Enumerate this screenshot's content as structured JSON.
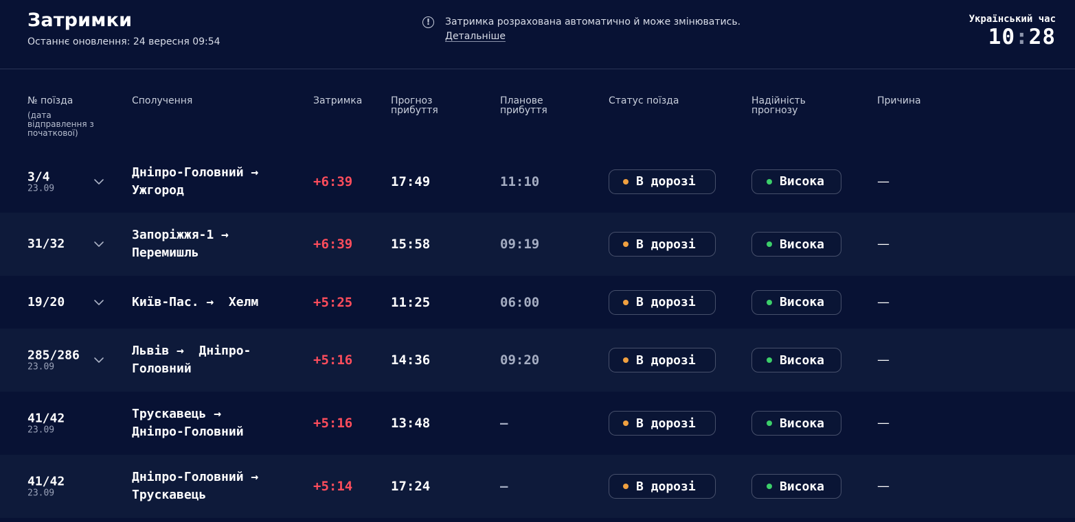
{
  "header": {
    "title": "Затримки",
    "updated": "Останнє оновлення: 24 вересня 09:54",
    "notice": "Затримка розрахована автоматично й може змінюватись.",
    "notice_link": "Детальніше",
    "notice_icon": "!",
    "clock_label": "Український час",
    "clock_hours": "10",
    "clock_separator": ":",
    "clock_minutes": "28"
  },
  "columns": {
    "train": "№ поїзда",
    "train_sub": "(дата відправлення з початкової)",
    "route": "Сполучення",
    "delay": "Затримка",
    "forecast": "Прогноз прибуття",
    "planned": "Планове прибуття",
    "status": "Статус поїзда",
    "reliability": "Надійність прогнозу",
    "reason": "Причина"
  },
  "colors": {
    "background": "#081234",
    "row_alt": "#0e1a3a",
    "delay": "#ff4d5c",
    "status_dot": "#f0a040",
    "reliability_dot": "#3ccf6a"
  },
  "icons": {
    "arrow": "→",
    "expand": "chevron-down-icon",
    "info": "info-icon"
  },
  "rows": [
    {
      "train": "3/4",
      "date": "23.09",
      "from": "Дніпро-Головний",
      "to": "Ужгород",
      "route_line1": "Дніпро-Головний →",
      "route_line2": "Ужгород",
      "delay": "+6:39",
      "forecast": "17:49",
      "planned": "11:10",
      "status": "В дорозі",
      "reliability": "Висока",
      "reason": "—",
      "expandable": true
    },
    {
      "train": "31/32",
      "date": "",
      "from": "Запоріжжя-1",
      "to": "Перемишль",
      "route_line1": "Запоріжжя-1 →",
      "route_line2": "Перемишль",
      "delay": "+6:39",
      "forecast": "15:58",
      "planned": "09:19",
      "status": "В дорозі",
      "reliability": "Висока",
      "reason": "—",
      "expandable": true
    },
    {
      "train": "19/20",
      "date": "",
      "from": "Київ-Пас.",
      "to": "Хелм",
      "route_line1": "Київ-Пас. →  Хелм",
      "route_line2": "",
      "delay": "+5:25",
      "forecast": "11:25",
      "planned": "06:00",
      "status": "В дорозі",
      "reliability": "Висока",
      "reason": "—",
      "expandable": true
    },
    {
      "train": "285/286",
      "date": "23.09",
      "from": "Львів",
      "to": "Дніпро-Головний",
      "route_line1": "Львів →  Дніпро-",
      "route_line2": "Головний",
      "delay": "+5:16",
      "forecast": "14:36",
      "planned": "09:20",
      "status": "В дорозі",
      "reliability": "Висока",
      "reason": "—",
      "expandable": true
    },
    {
      "train": "41/42",
      "date": "23.09",
      "from": "Трускавець",
      "to": "Дніпро-Головний",
      "route_line1": "Трускавець →",
      "route_line2": "Дніпро-Головний",
      "delay": "+5:16",
      "forecast": "13:48",
      "planned": "—",
      "status": "В дорозі",
      "reliability": "Висока",
      "reason": "—",
      "expandable": false
    },
    {
      "train": "41/42",
      "date": "23.09",
      "from": "Дніпро-Головний",
      "to": "Трускавець",
      "route_line1": "Дніпро-Головний →",
      "route_line2": "Трускавець",
      "delay": "+5:14",
      "forecast": "17:24",
      "planned": "—",
      "status": "В дорозі",
      "reliability": "Висока",
      "reason": "—",
      "expandable": false
    }
  ]
}
